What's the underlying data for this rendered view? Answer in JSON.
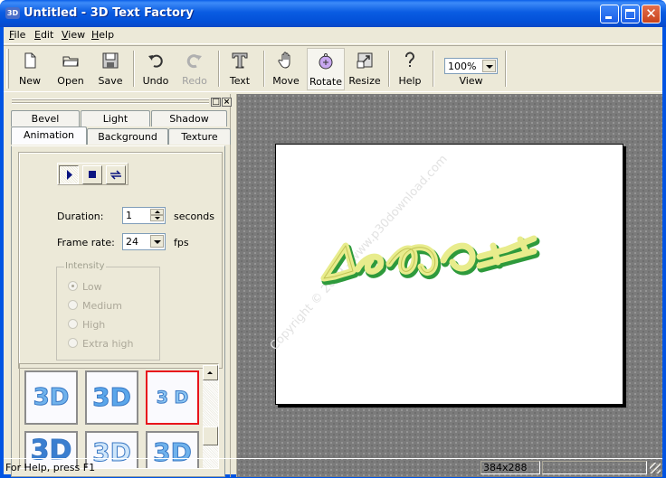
{
  "window": {
    "title": "Untitled - 3D Text Factory",
    "app_icon": "3D",
    "controls": {
      "minimize": "minimize-icon",
      "maximize": "maximize-icon",
      "close": "✕"
    }
  },
  "menu": [
    "File",
    "Edit",
    "View",
    "Help"
  ],
  "menu_mnemonics": [
    "F",
    "E",
    "V",
    "H"
  ],
  "toolbar": {
    "items": [
      {
        "label": "New",
        "icon": "new-document-icon",
        "enabled": true
      },
      {
        "label": "Open",
        "icon": "open-folder-icon",
        "enabled": true
      },
      {
        "label": "Save",
        "icon": "save-disk-icon",
        "enabled": true
      },
      {
        "label": "Undo",
        "icon": "undo-icon",
        "enabled": true
      },
      {
        "label": "Redo",
        "icon": "redo-icon",
        "enabled": false
      },
      {
        "label": "Text",
        "icon": "text-t-icon",
        "enabled": true
      },
      {
        "label": "Move",
        "icon": "hand-icon",
        "enabled": true
      },
      {
        "label": "Rotate",
        "icon": "rotate-icon",
        "enabled": true,
        "active": true
      },
      {
        "label": "Resize",
        "icon": "resize-icon",
        "enabled": true
      },
      {
        "label": "Help",
        "icon": "help-question-icon",
        "enabled": true
      }
    ],
    "zoom": {
      "value": "100%",
      "label": "View"
    }
  },
  "panel": {
    "tabs_row1": [
      "Bevel",
      "Light",
      "Shadow"
    ],
    "tabs_row2": [
      "Animation",
      "Background",
      "Texture"
    ],
    "active_tab": "Animation",
    "playback": [
      "play",
      "stop",
      "loop"
    ],
    "duration": {
      "label": "Duration:",
      "value": "1",
      "unit": "seconds"
    },
    "frame_rate": {
      "label": "Frame rate:",
      "value": "24",
      "unit": "fps"
    },
    "intensity": {
      "title": "Intensity",
      "options": [
        "Low",
        "Medium",
        "High",
        "Extra high"
      ],
      "selected": "Low",
      "enabled": false
    },
    "styles": [
      {
        "text": "3D",
        "selected": false
      },
      {
        "text": "3D",
        "selected": false
      },
      {
        "text": "3 D",
        "selected": true
      },
      {
        "text": "3D",
        "selected": false
      },
      {
        "text": "3D",
        "selected": false
      },
      {
        "text": "3D",
        "selected": false
      }
    ]
  },
  "canvas": {
    "watermark": "Copyright © 2009 - www.p30download.com",
    "colors": {
      "text_face": "#e8ec8c",
      "text_side": "#2e9a3c",
      "background": "#7b7b7b"
    }
  },
  "status": {
    "help_text": "For Help, press F1",
    "dimensions": "384x288",
    "extra": ""
  },
  "colors": {
    "titlebar": "#0a5ce2",
    "chrome": "#ece9d8",
    "selected_style": "#e8141c"
  }
}
